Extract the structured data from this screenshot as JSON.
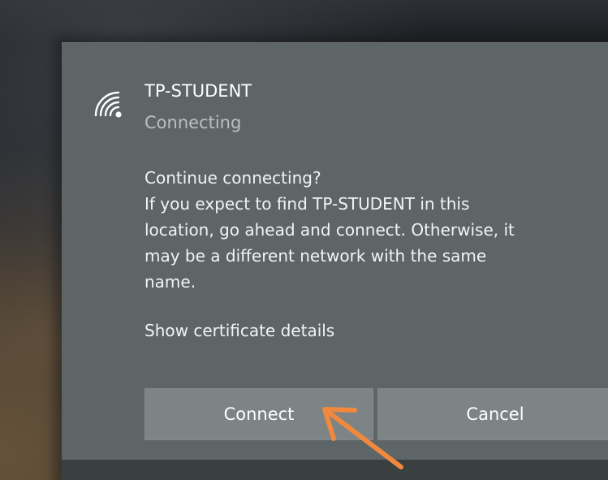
{
  "network": {
    "name": "TP-STUDENT",
    "status": "Connecting",
    "icon": "wifi-secured-icon"
  },
  "message": {
    "lines": [
      "Continue connecting?",
      "If you expect to find TP-STUDENT in this",
      "location, go ahead and connect. Otherwise, it",
      "may be a different network with the same",
      "name."
    ]
  },
  "link": {
    "show_certificate": "Show certificate details"
  },
  "buttons": {
    "connect": "Connect",
    "cancel": "Cancel"
  },
  "annotation": {
    "icon": "pointer-arrow-icon",
    "color": "#f0883e"
  },
  "colors": {
    "panel": "#5d6566",
    "button": "#7c8485",
    "text": "#ffffff",
    "status_text": "#b9c0c0"
  }
}
